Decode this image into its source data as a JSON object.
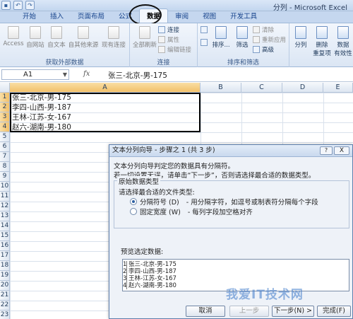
{
  "window": {
    "title": "分列 - Microsoft Excel"
  },
  "ribbon_tabs": [
    "开始",
    "插入",
    "页面布局",
    "公式",
    "数据",
    "审阅",
    "视图",
    "开发工具"
  ],
  "ribbon": {
    "external_data": {
      "access": "Access",
      "web": "自网站",
      "text": "自文本",
      "other": "自其他来源",
      "existing": "现有连接",
      "label": "获取外部数据"
    },
    "connections": {
      "refresh": "全部刷新",
      "conn": "连接",
      "props": "属性",
      "edit_links": "编辑链接",
      "label": "连接"
    },
    "sort_filter": {
      "sort": "排序...",
      "filter": "筛选",
      "clear": "清除",
      "reapply": "重新应用",
      "advanced": "高级",
      "label": "排序和筛选"
    },
    "data_tools": {
      "split": "分列",
      "remove_dup": "删除\n重复项",
      "validation": "数据\n有效性"
    }
  },
  "formula_bar": {
    "cell_ref": "A1",
    "fx": "fx",
    "content": "张三-北京-男-175"
  },
  "columns": [
    "A",
    "B",
    "C",
    "D",
    "E"
  ],
  "rows": [
    "1",
    "2",
    "3",
    "4",
    "5",
    "6",
    "7",
    "8",
    "9",
    "10",
    "11",
    "12",
    "13",
    "14",
    "15",
    "16",
    "17",
    "18",
    "19",
    "20",
    "21",
    "22",
    "23"
  ],
  "cells": [
    "张三-北京-男-175",
    "李四-山西-男-187",
    "王林-江苏-女-167",
    "赵六-湖南-男-180"
  ],
  "dialog": {
    "title": "文本分列向导 - 步骤之 1 (共 3 步)",
    "help": "?",
    "close": "X",
    "intro1": "文本分列向导判定您的数据具有分隔符。",
    "intro2": "若一切设置无误，请单击“下一步”，否则请选择最合适的数据类型。",
    "group_label": "原始数据类型",
    "choose_label": "请选择最合适的文件类型:",
    "options": [
      {
        "label": "分隔符号 (D)",
        "desc": "- 用分隔字符，如逗号或制表符分隔每个字段",
        "selected": true
      },
      {
        "label": "固定宽度 (W)",
        "desc": "- 每列字段加空格对齐",
        "selected": false
      }
    ],
    "preview_label": "预览选定数据:",
    "preview_rows": [
      {
        "n": "1",
        "text": "张三-北京-男-175"
      },
      {
        "n": "2",
        "text": "李四-山西-男-187"
      },
      {
        "n": "3",
        "text": "王林-江苏-女-167"
      },
      {
        "n": "4",
        "text": "赵六-湖南-男-180"
      }
    ],
    "buttons": {
      "cancel": "取消",
      "back": "上一步",
      "next": "下一步(N) >",
      "finish": "完成(F)"
    }
  },
  "watermark": "我爱IT技术网"
}
